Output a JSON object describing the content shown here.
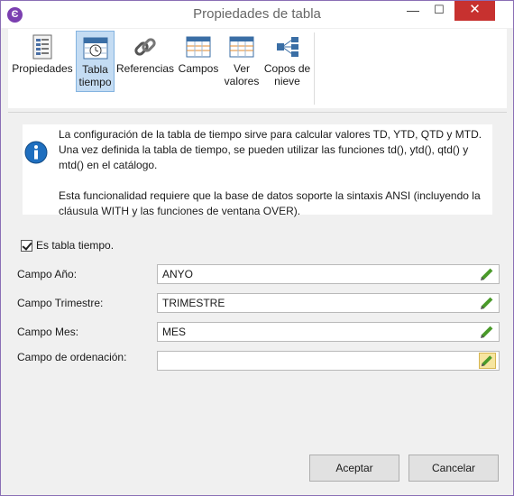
{
  "window": {
    "title": "Propiedades de tabla",
    "app_icon": "Є"
  },
  "window_controls": {
    "minimize": "—",
    "maximize": "☐",
    "close": "✕"
  },
  "toolbar": {
    "items": [
      {
        "line1": "Propiedades",
        "line2": "",
        "icon": "properties-icon"
      },
      {
        "line1": "Tabla",
        "line2": "tiempo",
        "icon": "calendar-clock-icon"
      },
      {
        "line1": "Referencias",
        "line2": "",
        "icon": "chain-link-icon"
      },
      {
        "line1": "Campos",
        "line2": "",
        "icon": "grid-icon"
      },
      {
        "line1": "Ver",
        "line2": "valores",
        "icon": "grid-values-icon"
      },
      {
        "line1": "Copos de",
        "line2": "nieve",
        "icon": "snowflake-tree-icon"
      }
    ],
    "active_index": 1
  },
  "info": {
    "paragraph1": "La configuración de la tabla de tiempo sirve para calcular valores TD, YTD, QTD y MTD. Una vez definida la tabla de tiempo, se pueden utilizar las funciones td(), ytd(), qtd() y mtd() en el catálogo.",
    "paragraph2": "Esta funcionalidad requiere que la base de datos soporte la sintaxis ANSI (incluyendo la cláusula WITH y las funciones de ventana OVER)."
  },
  "form": {
    "is_time_table_label": "Es tabla tiempo.",
    "is_time_table_checked": true,
    "year_label": "Campo Año:",
    "year_value": "ANYO",
    "quarter_label": "Campo Trimestre:",
    "quarter_value": "TRIMESTRE",
    "month_label": "Campo Mes:",
    "month_value": "MES",
    "order_label": "Campo de ordenación:",
    "order_value": ""
  },
  "buttons": {
    "accept": "Aceptar",
    "cancel": "Cancelar"
  },
  "colors": {
    "accent": "#7b3fb0",
    "close_red": "#c7312f",
    "active_tool": "#c4dcf3",
    "info_blue": "#1f6fbf"
  }
}
